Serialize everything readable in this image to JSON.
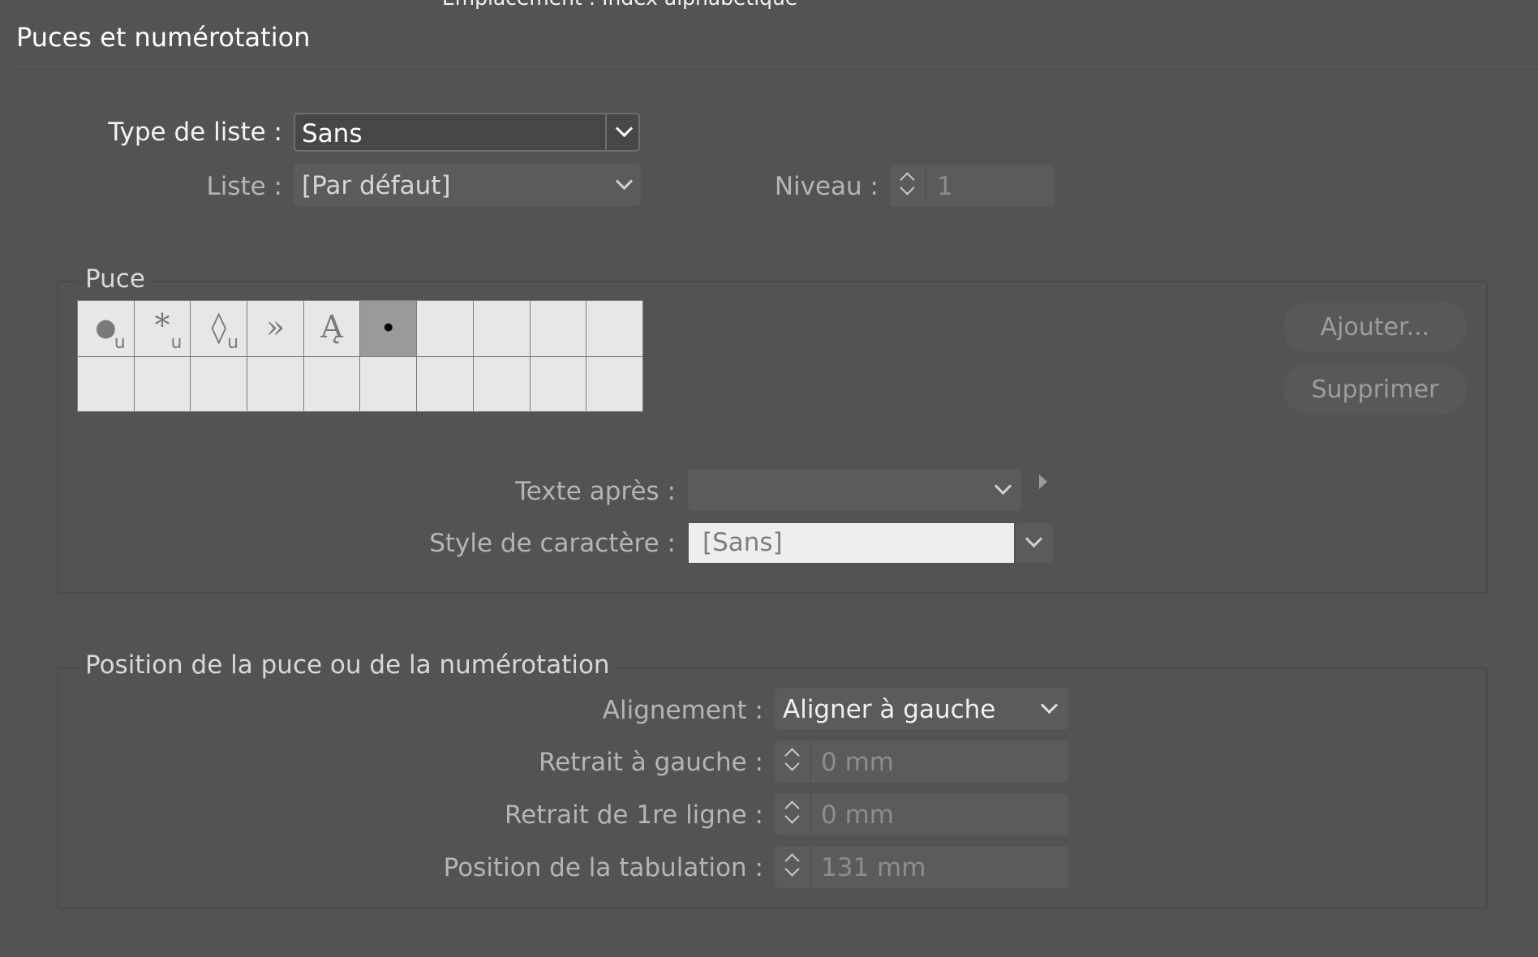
{
  "window": {
    "location_label": "Emplacement : Index alphabétique"
  },
  "section": {
    "title": "Puces et numérotation"
  },
  "list_type": {
    "label": "Type de liste :",
    "value": "Sans"
  },
  "list": {
    "label": "Liste :",
    "value": "[Par défaut]"
  },
  "level": {
    "label": "Niveau :",
    "value": "1"
  },
  "bullet_group": {
    "legend": "Puce",
    "glyphs": [
      {
        "char": "●",
        "sub": "u"
      },
      {
        "char": "*",
        "sub": "u"
      },
      {
        "char": "◊",
        "sub": "u"
      },
      {
        "char": "»",
        "sub": ""
      },
      {
        "char": "Ą",
        "sub": ""
      },
      {
        "char": "•",
        "sub": ""
      }
    ],
    "add_button": "Ajouter...",
    "delete_button": "Supprimer",
    "text_after_label": "Texte après :",
    "text_after_value": "",
    "char_style_label": "Style de caractère :",
    "char_style_value": "[Sans]"
  },
  "position_group": {
    "legend": "Position de la puce ou de la numérotation",
    "alignment_label": "Alignement :",
    "alignment_value": "Aligner à gauche",
    "left_indent_label": "Retrait à gauche :",
    "left_indent_value": "0 mm",
    "first_line_label": "Retrait de 1re ligne :",
    "first_line_value": "0 mm",
    "tab_position_label": "Position de la tabulation :",
    "tab_position_value": "131 mm"
  },
  "colors": {
    "panel_bg": "#535353",
    "selected_glyph": "#9a9a9a"
  }
}
